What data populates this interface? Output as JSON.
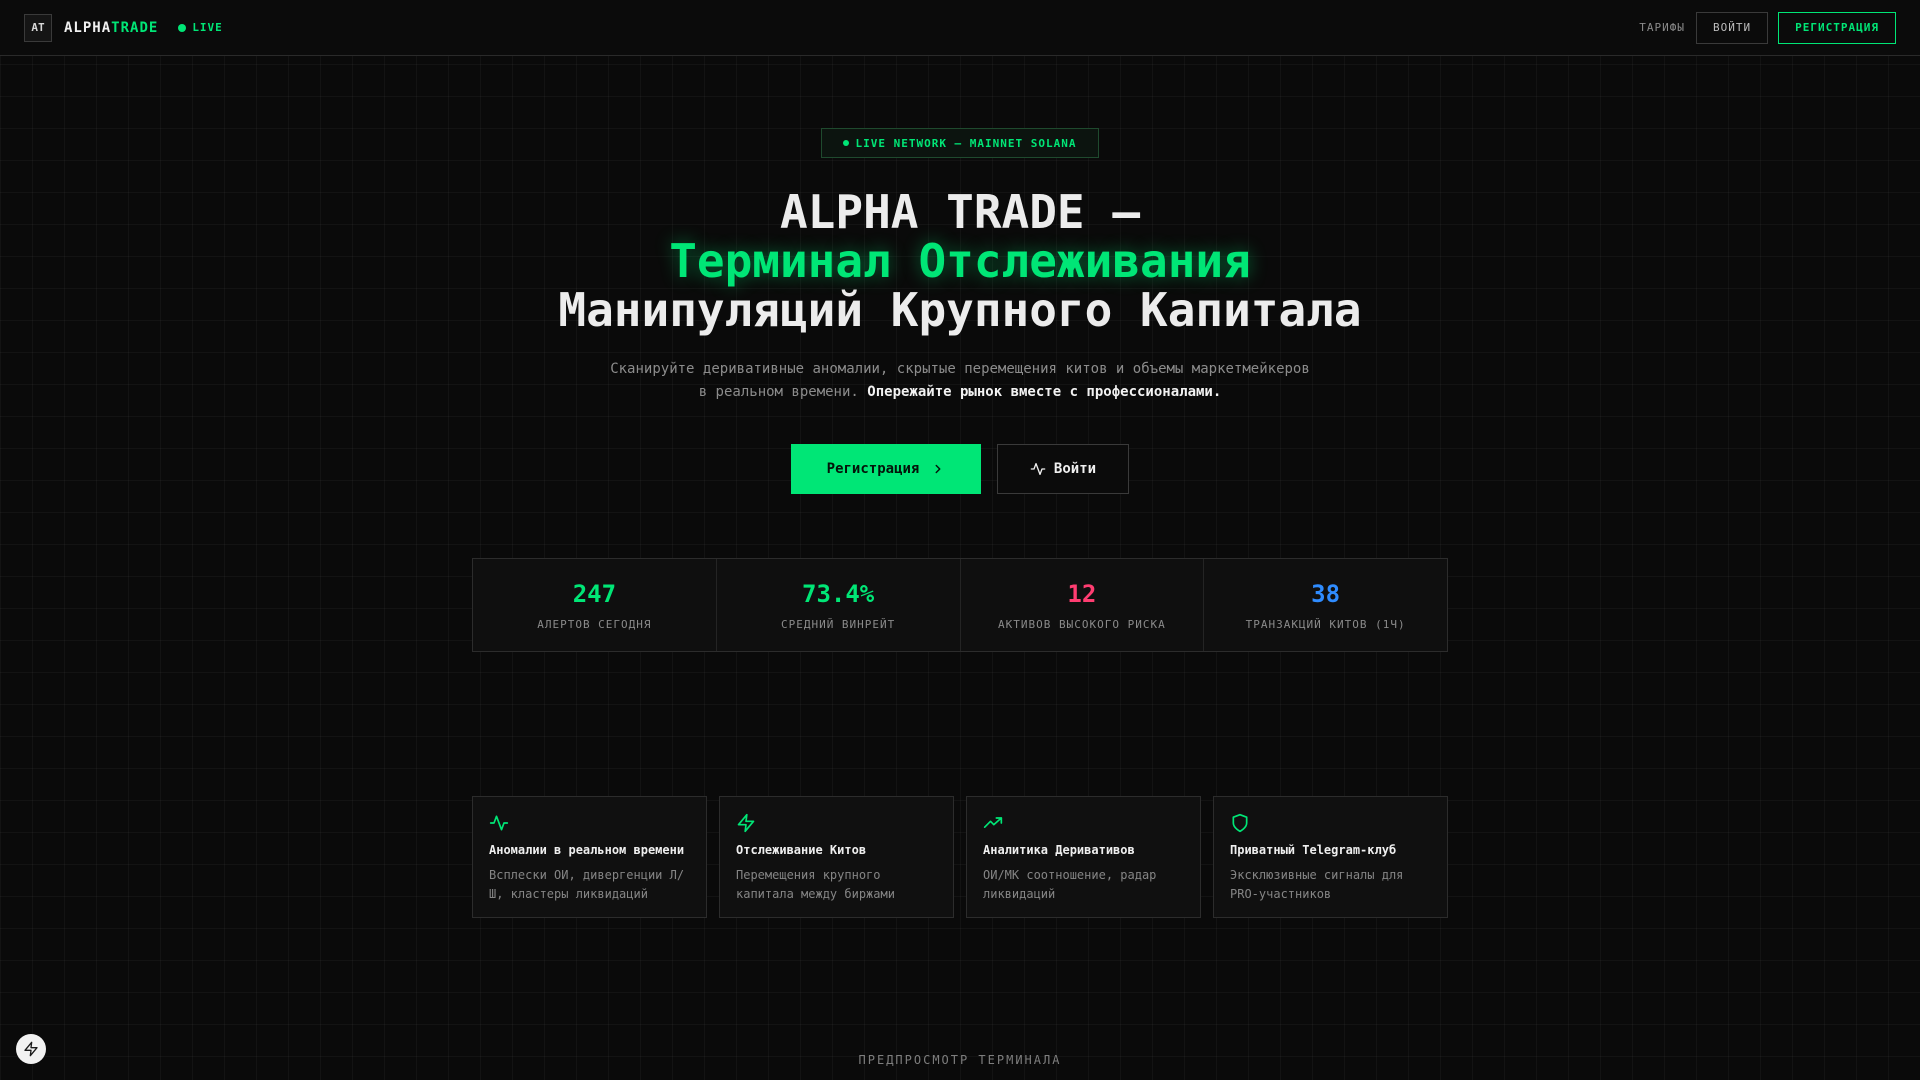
{
  "header": {
    "logo": "AT",
    "brand_primary": "ALPHA",
    "brand_accent": "TRADE",
    "live_label": "LIVE",
    "nav_tariffs": "ТАРИФЫ",
    "nav_login": "ВОЙТИ",
    "nav_signup": "РЕГИСТРАЦИЯ"
  },
  "hero": {
    "badge": "LIVE NETWORK — MAINNET SOLANA",
    "title_line1": "ALPHA TRADE —",
    "title_line2": "Терминал Отслеживания",
    "title_line3": "Манипуляций Крупного Капитала",
    "subtitle_line1": "Сканируйте деривативные аномалии, скрытые перемещения китов и объемы маркетмейкеров",
    "subtitle_line2": "в реальном времени.",
    "subtitle_strong": "Опережайте рынок вместе с профессионалами.",
    "cta_primary": "Регистрация",
    "cta_secondary": "Войти"
  },
  "stats": [
    {
      "value": "247",
      "label": "АЛЕРТОВ СЕГОДНЯ",
      "color": "#00e676"
    },
    {
      "value": "73.4%",
      "label": "СРЕДНИЙ ВИНРЕЙТ",
      "color": "#00e676"
    },
    {
      "value": "12",
      "label": "АКТИВОВ ВЫСОКОГО РИСКА",
      "color": "#ff3d71"
    },
    {
      "value": "38",
      "label": "ТРАНЗАКЦИЙ КИТОВ (1Ч)",
      "color": "#2f8cff"
    }
  ],
  "features": [
    {
      "icon": "activity-icon",
      "title": "Аномалии в реальном времени",
      "desc": "Всплески ОИ, дивергенции Л/Ш, кластеры ликвидаций"
    },
    {
      "icon": "zap-icon",
      "title": "Отслеживание Китов",
      "desc": "Перемещения крупного капитала между биржами"
    },
    {
      "icon": "trending-up-icon",
      "title": "Аналитика Деривативов",
      "desc": "ОИ/МК соотношение, радар ликвидаций"
    },
    {
      "icon": "shield-icon",
      "title": "Приватный Telegram-клуб",
      "desc": "Эксклюзивные сигналы для PRO-участников"
    }
  ],
  "footer": {
    "preview_label": "ПРЕДПРОСМОТР ТЕРМИНАЛА"
  },
  "colors": {
    "accent": "#00e676",
    "danger": "#ff3d71",
    "info": "#2f8cff",
    "background": "#0a0a0a"
  }
}
